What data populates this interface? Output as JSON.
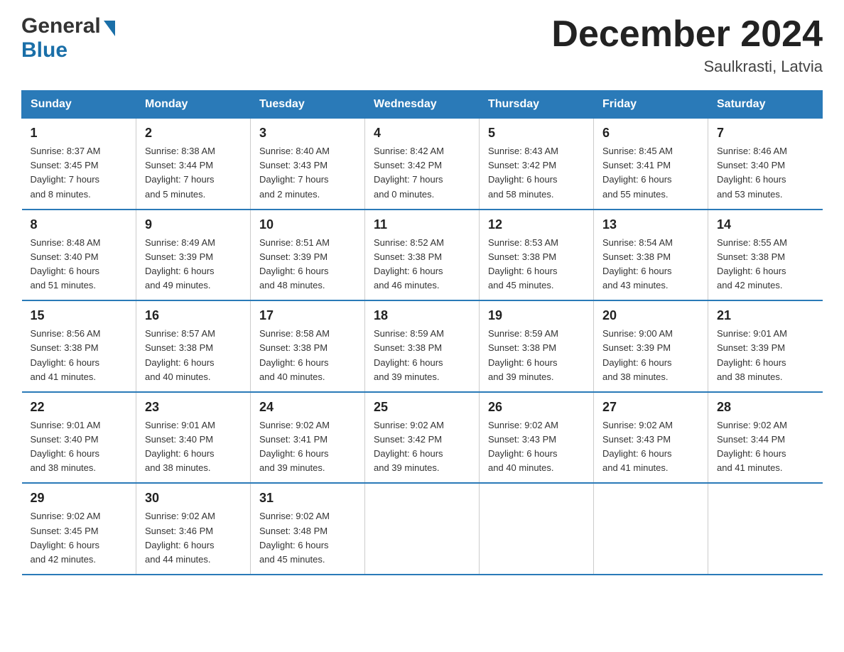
{
  "header": {
    "logo_general": "General",
    "logo_blue": "Blue",
    "month_title": "December 2024",
    "location": "Saulkrasti, Latvia"
  },
  "days_of_week": [
    "Sunday",
    "Monday",
    "Tuesday",
    "Wednesday",
    "Thursday",
    "Friday",
    "Saturday"
  ],
  "weeks": [
    [
      {
        "day": "1",
        "sunrise": "8:37 AM",
        "sunset": "3:45 PM",
        "daylight": "7 hours and 8 minutes."
      },
      {
        "day": "2",
        "sunrise": "8:38 AM",
        "sunset": "3:44 PM",
        "daylight": "7 hours and 5 minutes."
      },
      {
        "day": "3",
        "sunrise": "8:40 AM",
        "sunset": "3:43 PM",
        "daylight": "7 hours and 2 minutes."
      },
      {
        "day": "4",
        "sunrise": "8:42 AM",
        "sunset": "3:42 PM",
        "daylight": "7 hours and 0 minutes."
      },
      {
        "day": "5",
        "sunrise": "8:43 AM",
        "sunset": "3:42 PM",
        "daylight": "6 hours and 58 minutes."
      },
      {
        "day": "6",
        "sunrise": "8:45 AM",
        "sunset": "3:41 PM",
        "daylight": "6 hours and 55 minutes."
      },
      {
        "day": "7",
        "sunrise": "8:46 AM",
        "sunset": "3:40 PM",
        "daylight": "6 hours and 53 minutes."
      }
    ],
    [
      {
        "day": "8",
        "sunrise": "8:48 AM",
        "sunset": "3:40 PM",
        "daylight": "6 hours and 51 minutes."
      },
      {
        "day": "9",
        "sunrise": "8:49 AM",
        "sunset": "3:39 PM",
        "daylight": "6 hours and 49 minutes."
      },
      {
        "day": "10",
        "sunrise": "8:51 AM",
        "sunset": "3:39 PM",
        "daylight": "6 hours and 48 minutes."
      },
      {
        "day": "11",
        "sunrise": "8:52 AM",
        "sunset": "3:38 PM",
        "daylight": "6 hours and 46 minutes."
      },
      {
        "day": "12",
        "sunrise": "8:53 AM",
        "sunset": "3:38 PM",
        "daylight": "6 hours and 45 minutes."
      },
      {
        "day": "13",
        "sunrise": "8:54 AM",
        "sunset": "3:38 PM",
        "daylight": "6 hours and 43 minutes."
      },
      {
        "day": "14",
        "sunrise": "8:55 AM",
        "sunset": "3:38 PM",
        "daylight": "6 hours and 42 minutes."
      }
    ],
    [
      {
        "day": "15",
        "sunrise": "8:56 AM",
        "sunset": "3:38 PM",
        "daylight": "6 hours and 41 minutes."
      },
      {
        "day": "16",
        "sunrise": "8:57 AM",
        "sunset": "3:38 PM",
        "daylight": "6 hours and 40 minutes."
      },
      {
        "day": "17",
        "sunrise": "8:58 AM",
        "sunset": "3:38 PM",
        "daylight": "6 hours and 40 minutes."
      },
      {
        "day": "18",
        "sunrise": "8:59 AM",
        "sunset": "3:38 PM",
        "daylight": "6 hours and 39 minutes."
      },
      {
        "day": "19",
        "sunrise": "8:59 AM",
        "sunset": "3:38 PM",
        "daylight": "6 hours and 39 minutes."
      },
      {
        "day": "20",
        "sunrise": "9:00 AM",
        "sunset": "3:39 PM",
        "daylight": "6 hours and 38 minutes."
      },
      {
        "day": "21",
        "sunrise": "9:01 AM",
        "sunset": "3:39 PM",
        "daylight": "6 hours and 38 minutes."
      }
    ],
    [
      {
        "day": "22",
        "sunrise": "9:01 AM",
        "sunset": "3:40 PM",
        "daylight": "6 hours and 38 minutes."
      },
      {
        "day": "23",
        "sunrise": "9:01 AM",
        "sunset": "3:40 PM",
        "daylight": "6 hours and 38 minutes."
      },
      {
        "day": "24",
        "sunrise": "9:02 AM",
        "sunset": "3:41 PM",
        "daylight": "6 hours and 39 minutes."
      },
      {
        "day": "25",
        "sunrise": "9:02 AM",
        "sunset": "3:42 PM",
        "daylight": "6 hours and 39 minutes."
      },
      {
        "day": "26",
        "sunrise": "9:02 AM",
        "sunset": "3:43 PM",
        "daylight": "6 hours and 40 minutes."
      },
      {
        "day": "27",
        "sunrise": "9:02 AM",
        "sunset": "3:43 PM",
        "daylight": "6 hours and 41 minutes."
      },
      {
        "day": "28",
        "sunrise": "9:02 AM",
        "sunset": "3:44 PM",
        "daylight": "6 hours and 41 minutes."
      }
    ],
    [
      {
        "day": "29",
        "sunrise": "9:02 AM",
        "sunset": "3:45 PM",
        "daylight": "6 hours and 42 minutes."
      },
      {
        "day": "30",
        "sunrise": "9:02 AM",
        "sunset": "3:46 PM",
        "daylight": "6 hours and 44 minutes."
      },
      {
        "day": "31",
        "sunrise": "9:02 AM",
        "sunset": "3:48 PM",
        "daylight": "6 hours and 45 minutes."
      },
      null,
      null,
      null,
      null
    ]
  ],
  "labels": {
    "sunrise_prefix": "Sunrise: ",
    "sunset_prefix": "Sunset: ",
    "daylight_prefix": "Daylight: "
  },
  "colors": {
    "header_bg": "#2a7ab8",
    "border": "#2a7ab8"
  }
}
